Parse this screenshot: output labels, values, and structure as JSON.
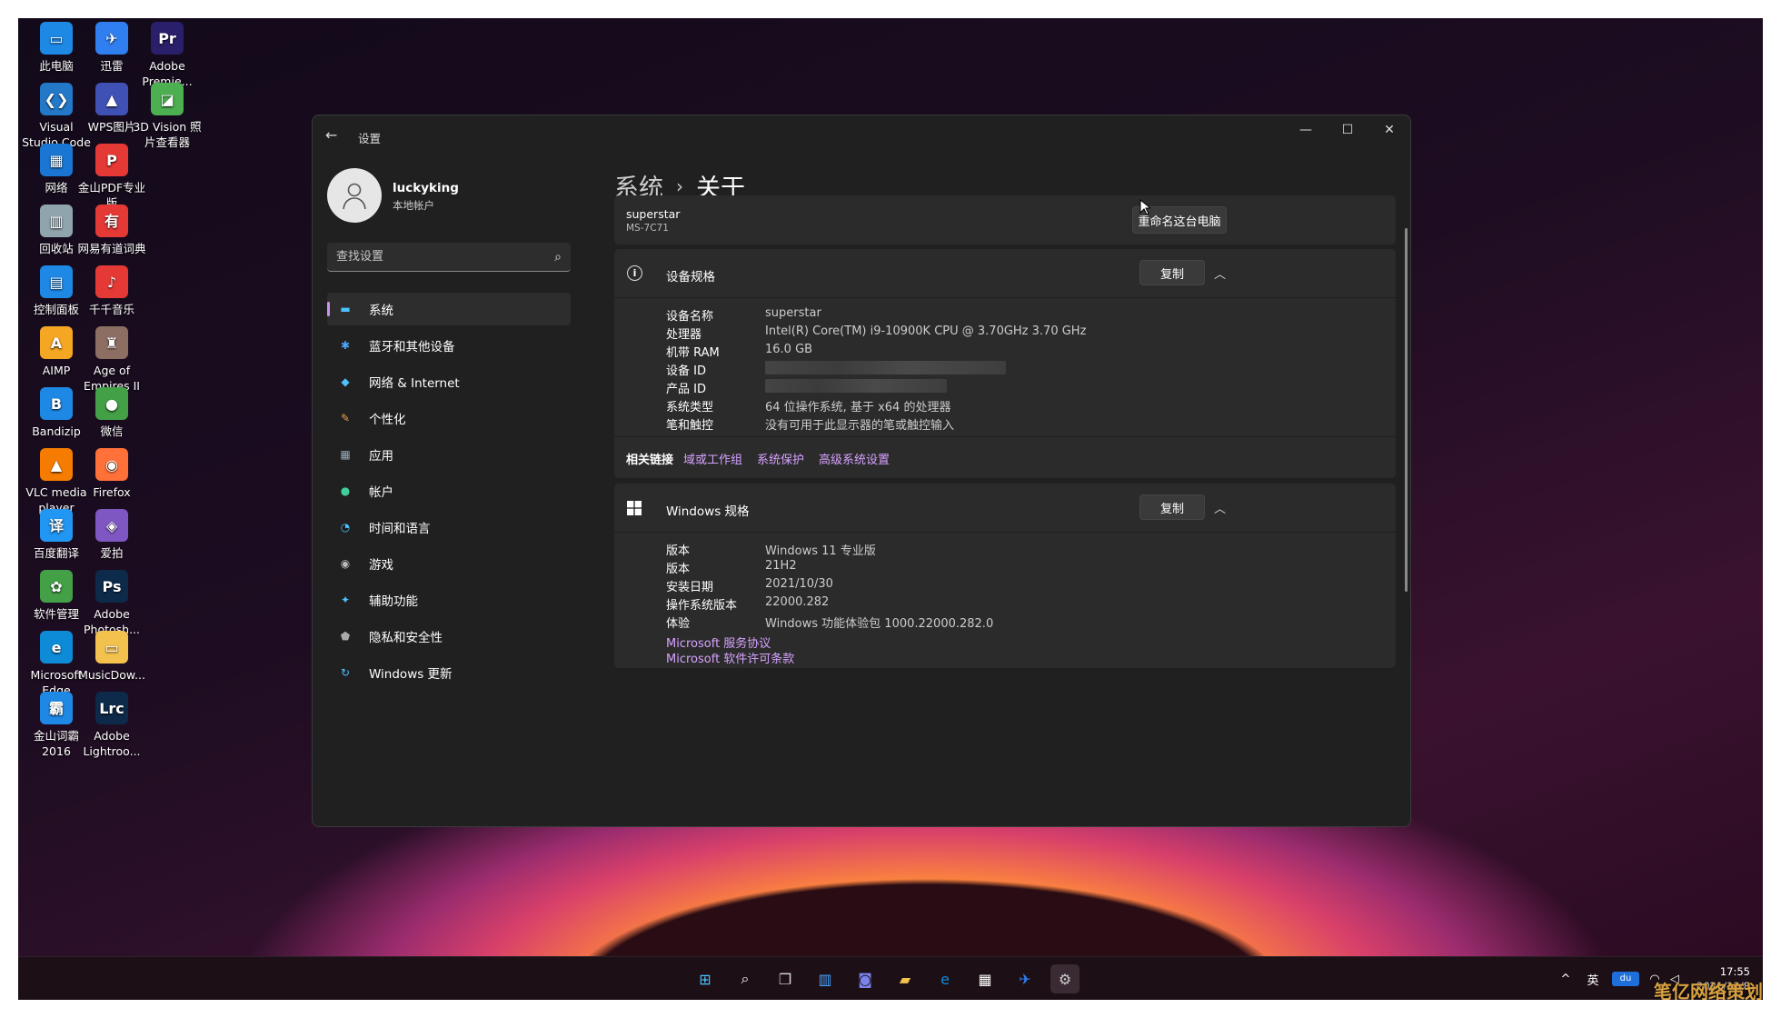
{
  "desktop": {
    "icons": [
      {
        "label": "此电脑",
        "col": 0,
        "row": 0,
        "color": "#1e88e5",
        "glyph": "▭"
      },
      {
        "label": "迅雷",
        "col": 1,
        "row": 0,
        "color": "#2f7ff0",
        "glyph": "✈"
      },
      {
        "label": "Adobe Premie...",
        "col": 2,
        "row": 0,
        "color": "#2a1f6a",
        "glyph": "Pr"
      },
      {
        "label": "Visual Studio Code",
        "col": 0,
        "row": 1,
        "color": "#2378c8",
        "glyph": "❮❯"
      },
      {
        "label": "WPS图片",
        "col": 1,
        "row": 1,
        "color": "#3f51b5",
        "glyph": "▲"
      },
      {
        "label": "3D Vision 照片查看器",
        "col": 2,
        "row": 1,
        "color": "#4caf50",
        "glyph": "◪"
      },
      {
        "label": "网络",
        "col": 0,
        "row": 2,
        "color": "#1976d2",
        "glyph": "▦"
      },
      {
        "label": "金山PDF专业版",
        "col": 1,
        "row": 2,
        "color": "#e53935",
        "glyph": "P"
      },
      {
        "label": "回收站",
        "col": 0,
        "row": 3,
        "color": "#90a4ae",
        "glyph": "▥"
      },
      {
        "label": "网易有道词典",
        "col": 1,
        "row": 3,
        "color": "#e53935",
        "glyph": "有"
      },
      {
        "label": "控制面板",
        "col": 0,
        "row": 4,
        "color": "#1e88e5",
        "glyph": "▤"
      },
      {
        "label": "千千音乐",
        "col": 1,
        "row": 4,
        "color": "#e53935",
        "glyph": "♪"
      },
      {
        "label": "AIMP",
        "col": 0,
        "row": 5,
        "color": "#f5a623",
        "glyph": "A"
      },
      {
        "label": "Age of Empires II",
        "col": 1,
        "row": 5,
        "color": "#8d6e63",
        "glyph": "♜"
      },
      {
        "label": "Bandizip",
        "col": 0,
        "row": 6,
        "color": "#1e88e5",
        "glyph": "B"
      },
      {
        "label": "微信",
        "col": 1,
        "row": 6,
        "color": "#43a047",
        "glyph": "●"
      },
      {
        "label": "VLC media player",
        "col": 0,
        "row": 7,
        "color": "#f57c00",
        "glyph": "▲"
      },
      {
        "label": "Firefox",
        "col": 1,
        "row": 7,
        "color": "#ff7139",
        "glyph": "◉"
      },
      {
        "label": "百度翻译",
        "col": 0,
        "row": 8,
        "color": "#2196f3",
        "glyph": "译"
      },
      {
        "label": "爱拍",
        "col": 1,
        "row": 8,
        "color": "#7e57c2",
        "glyph": "◈"
      },
      {
        "label": "软件管理",
        "col": 0,
        "row": 9,
        "color": "#43a047",
        "glyph": "✿"
      },
      {
        "label": "Adobe Photosh...",
        "col": 1,
        "row": 9,
        "color": "#0d2a4a",
        "glyph": "Ps"
      },
      {
        "label": "Microsoft Edge",
        "col": 0,
        "row": 10,
        "color": "#0e8bd6",
        "glyph": "e"
      },
      {
        "label": "MusicDow...",
        "col": 1,
        "row": 10,
        "color": "#f2c14e",
        "glyph": "▭"
      },
      {
        "label": "金山词霸 2016",
        "col": 0,
        "row": 11,
        "color": "#1e88e5",
        "glyph": "霸"
      },
      {
        "label": "Adobe Lightroo...",
        "col": 1,
        "row": 11,
        "color": "#0d2a4a",
        "glyph": "Lrc"
      }
    ]
  },
  "window": {
    "app_title": "设置",
    "caption": {
      "minimize": "—",
      "maximize": "☐",
      "close": "✕"
    },
    "user": {
      "name": "luckyking",
      "type": "本地帐户"
    },
    "search": {
      "placeholder": "查找设置"
    },
    "nav": [
      {
        "label": "系统",
        "icon": "▬",
        "color": "#4cc2ff",
        "active": true
      },
      {
        "label": "蓝牙和其他设备",
        "icon": "✱",
        "color": "#4ca6ff",
        "active": false
      },
      {
        "label": "网络 & Internet",
        "icon": "◆",
        "color": "#4cc2ff",
        "active": false
      },
      {
        "label": "个性化",
        "icon": "✎",
        "color": "#e8a04c",
        "active": false
      },
      {
        "label": "应用",
        "icon": "▦",
        "color": "#9ab",
        "active": false
      },
      {
        "label": "帐户",
        "icon": "●",
        "color": "#3ecf9b",
        "active": false
      },
      {
        "label": "时间和语言",
        "icon": "◔",
        "color": "#4cc2ff",
        "active": false
      },
      {
        "label": "游戏",
        "icon": "◉",
        "color": "#bbb",
        "active": false
      },
      {
        "label": "辅助功能",
        "icon": "✦",
        "color": "#4cc2ff",
        "active": false
      },
      {
        "label": "隐私和安全性",
        "icon": "⬟",
        "color": "#aaa",
        "active": false
      },
      {
        "label": "Windows 更新",
        "icon": "↻",
        "color": "#4cc2ff",
        "active": false
      }
    ],
    "breadcrumb": {
      "parent": "系统",
      "separator": "›",
      "current": "关于"
    },
    "device_card": {
      "name": "superstar",
      "model": "MS-7C71",
      "rename_button": "重命名这台电脑"
    },
    "device_specs": {
      "title": "设备规格",
      "copy_button": "复制",
      "rows": [
        {
          "key": "设备名称",
          "value": "superstar"
        },
        {
          "key": "处理器",
          "value": "Intel(R) Core(TM) i9-10900K CPU @ 3.70GHz   3.70 GHz"
        },
        {
          "key": "机带 RAM",
          "value": "16.0 GB"
        },
        {
          "key": "设备 ID",
          "value": ""
        },
        {
          "key": "产品 ID",
          "value": ""
        },
        {
          "key": "系统类型",
          "value": "64 位操作系统, 基于 x64 的处理器"
        },
        {
          "key": "笔和触控",
          "value": "没有可用于此显示器的笔或触控输入"
        }
      ]
    },
    "related_links": {
      "label": "相关链接",
      "links": [
        "域或工作组",
        "系统保护",
        "高级系统设置"
      ]
    },
    "windows_specs": {
      "title": "Windows 规格",
      "copy_button": "复制",
      "rows": [
        {
          "key": "版本",
          "value": "Windows 11 专业版"
        },
        {
          "key": "版本",
          "value": "21H2"
        },
        {
          "key": "安装日期",
          "value": "2021/10/30"
        },
        {
          "key": "操作系统版本",
          "value": "22000.282"
        },
        {
          "key": "体验",
          "value": "Windows 功能体验包 1000.22000.282.0"
        }
      ],
      "links": [
        "Microsoft 服务协议",
        "Microsoft 软件许可条款"
      ]
    }
  },
  "taskbar": {
    "apps": [
      {
        "name": "start-icon",
        "glyph": "⊞",
        "color": "#4cc2ff"
      },
      {
        "name": "search-icon",
        "glyph": "⌕",
        "color": "#ffffff"
      },
      {
        "name": "task-view-icon",
        "glyph": "❐",
        "color": "#dddddd"
      },
      {
        "name": "widgets-icon",
        "glyph": "▥",
        "color": "#4ca6ff"
      },
      {
        "name": "teams-chat-icon",
        "glyph": "◙",
        "color": "#7b83eb"
      },
      {
        "name": "file-explorer-icon",
        "glyph": "▰",
        "color": "#f2c14e"
      },
      {
        "name": "edge-icon",
        "glyph": "e",
        "color": "#0e8bd6"
      },
      {
        "name": "store-icon",
        "glyph": "▦",
        "color": "#ffffff"
      },
      {
        "name": "xunlei-icon",
        "glyph": "✈",
        "color": "#2f7ff0"
      },
      {
        "name": "settings-icon",
        "glyph": "⚙",
        "color": "#cccccc"
      }
    ],
    "tray": {
      "chevron": "^",
      "ime": "英",
      "ime2": "du",
      "wifi": "◠",
      "volume": "◁"
    },
    "clock": {
      "time": "17:55",
      "date": "2021/11/8"
    }
  },
  "watermark": "笔亿网络策划"
}
